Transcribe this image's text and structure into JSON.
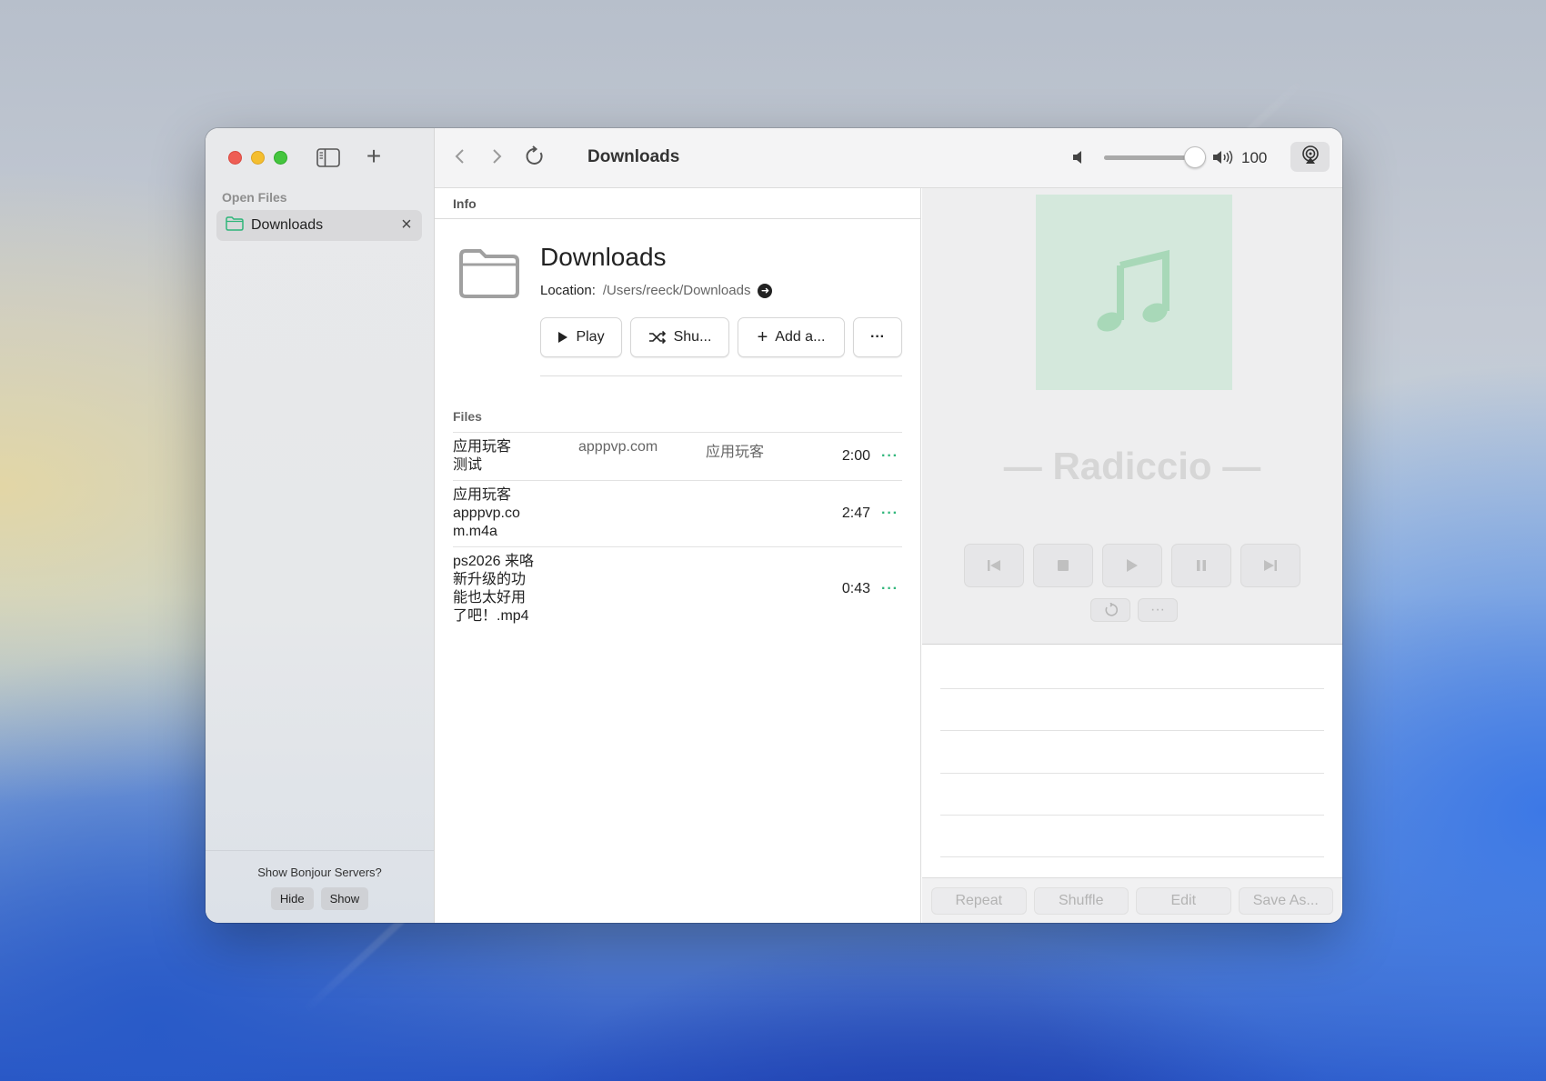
{
  "sidebar": {
    "section_title": "Open Files",
    "items": [
      {
        "label": "Downloads",
        "icon": "folder-icon"
      }
    ],
    "footer": {
      "question": "Show Bonjour Servers?",
      "hide_label": "Hide",
      "show_label": "Show"
    }
  },
  "toolbar": {
    "title": "Downloads",
    "volume": 100,
    "volume_fraction": 1.0
  },
  "info": {
    "header": "Info",
    "title": "Downloads",
    "location_label": "Location:",
    "location_path": "/Users/reeck/Downloads",
    "actions": {
      "play": "Play",
      "shuffle": "Shu...",
      "add": "Add a...",
      "more": "···"
    }
  },
  "files": {
    "header": "Files",
    "rows": [
      {
        "name": "应用玩客\n测试",
        "artist": "apppvp.com",
        "album": "应用玩客",
        "duration": "2:00",
        "more": "···"
      },
      {
        "name": "应用玩客\n apppvp.co\nm.m4a",
        "artist": "",
        "album": "",
        "duration": "2:47",
        "more": "···"
      },
      {
        "name": "ps2026 来咯\n新升级的功\n能也太好用\n了吧！.mp4",
        "artist": "",
        "album": "",
        "duration": "0:43",
        "more": "···"
      }
    ]
  },
  "player": {
    "title": "— Radiccio —",
    "more": "···",
    "art_color": "#d4e8dc",
    "note_color": "#a8d8b8"
  },
  "bottom_bar": {
    "repeat": "Repeat",
    "shuffle": "Shuffle",
    "edit": "Edit",
    "save_as": "Save As..."
  },
  "colors": {
    "accent": "#2fb67a",
    "folder": "#2fb67a"
  }
}
